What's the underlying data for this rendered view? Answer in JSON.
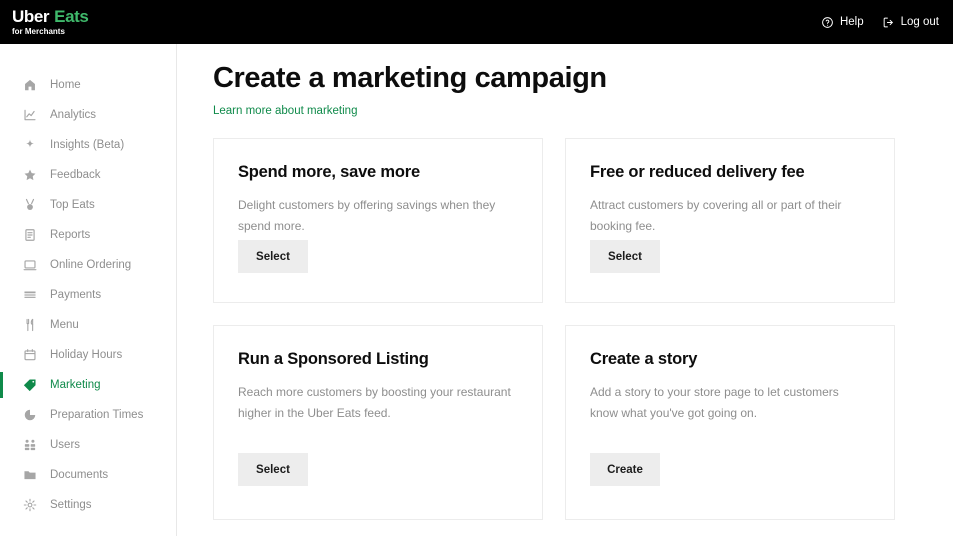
{
  "topbar": {
    "logo": {
      "word1": "Uber",
      "word2": "Eats",
      "subtitle": "for Merchants",
      "accent": "#3fb96b"
    },
    "help_label": "Help",
    "help_icon": "question-circle-icon",
    "logout_label": "Log out",
    "logout_icon": "logout-icon"
  },
  "sidebar": {
    "items": [
      {
        "label": "Home",
        "icon": "home-icon",
        "active": false
      },
      {
        "label": "Analytics",
        "icon": "chart-line-icon",
        "active": false
      },
      {
        "label": "Insights (Beta)",
        "icon": "sparkle-icon",
        "active": false
      },
      {
        "label": "Feedback",
        "icon": "star-icon",
        "active": false
      },
      {
        "label": "Top Eats",
        "icon": "medal-icon",
        "active": false
      },
      {
        "label": "Reports",
        "icon": "document-icon",
        "active": false
      },
      {
        "label": "Online Ordering",
        "icon": "laptop-icon",
        "active": false
      },
      {
        "label": "Payments",
        "icon": "card-icon",
        "active": false
      },
      {
        "label": "Menu",
        "icon": "utensils-icon",
        "active": false
      },
      {
        "label": "Holiday Hours",
        "icon": "calendar-icon",
        "active": false
      },
      {
        "label": "Marketing",
        "icon": "tag-icon",
        "active": true
      },
      {
        "label": "Preparation Times",
        "icon": "timer-icon",
        "active": false
      },
      {
        "label": "Users",
        "icon": "users-icon",
        "active": false
      },
      {
        "label": "Documents",
        "icon": "folder-icon",
        "active": false
      },
      {
        "label": "Settings",
        "icon": "gear-icon",
        "active": false
      }
    ],
    "active_color": "#0f8a4a",
    "inactive_color": "#8e8e8e"
  },
  "main": {
    "title": "Create a marketing campaign",
    "learn_more_link": "Learn more about marketing",
    "link_color": "#0f8a4a",
    "cards": [
      {
        "title": "Spend more, save more",
        "description": "Delight customers by offering savings when they spend more.",
        "button_label": "Select"
      },
      {
        "title": "Free or reduced delivery fee",
        "description": "Attract customers by covering all or part of their booking fee.",
        "button_label": "Select"
      },
      {
        "title": "Run a Sponsored Listing",
        "description": "Reach more customers by boosting your restaurant higher in the Uber Eats feed.",
        "button_label": "Select"
      },
      {
        "title": "Create a story",
        "description": "Add a story to your store page to let customers know what you've got going on.",
        "button_label": "Create"
      }
    ]
  }
}
